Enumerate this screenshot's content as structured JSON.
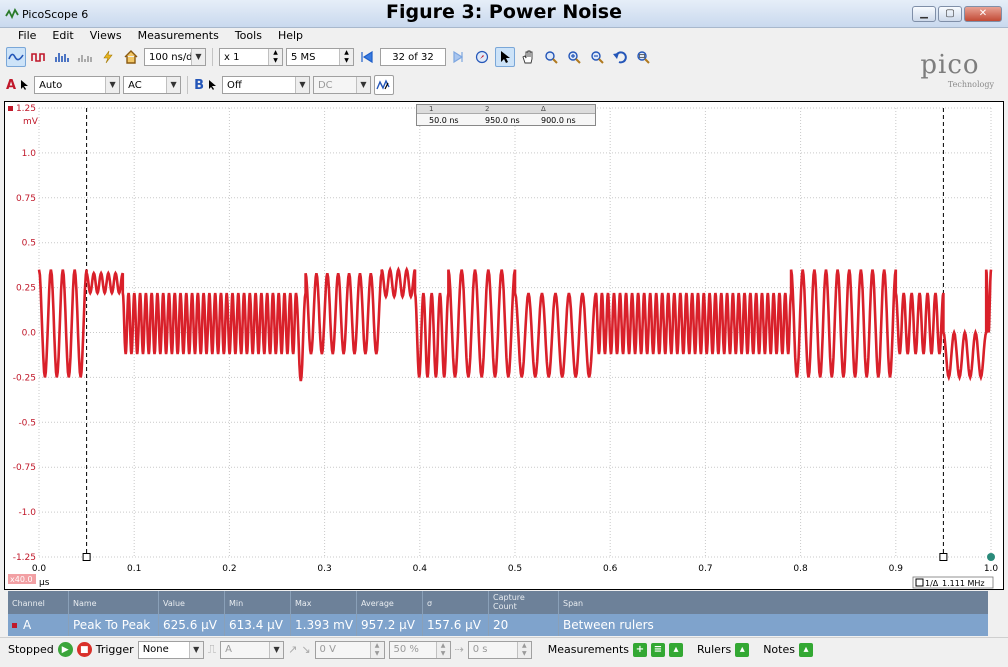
{
  "window": {
    "app_title": "PicoScope 6",
    "figure_title": "Figure 3: Power Noise",
    "controls": {
      "minimize": "▁",
      "maximize": "▢",
      "close": "✕"
    }
  },
  "menu": [
    "File",
    "Edit",
    "Views",
    "Measurements",
    "Tools",
    "Help"
  ],
  "toolbar": {
    "timebase": "100 ns/div",
    "zoom": "x 1",
    "samples": "5 MS",
    "capture": "32 of 32"
  },
  "channel_bar": {
    "channel_a_label": "A",
    "channel_a_range": "Auto",
    "channel_a_coupling": "AC",
    "channel_b_label": "B",
    "channel_b_range": "Off",
    "channel_b_coupling": "DC"
  },
  "logo": {
    "main": "pico",
    "sub": "Technology"
  },
  "ruler_legend": {
    "headers": [
      "1",
      "2",
      "Δ"
    ],
    "values": [
      "50.0 ns",
      "950.0 ns",
      "900.0 ns"
    ]
  },
  "scope": {
    "y_unit": "mV",
    "x_unit": "µs",
    "zoom_badge": "x40.0",
    "freq_readout": "1.111 MHz",
    "trace_color": "#d9202a",
    "grid_color": "#c9c9c9"
  },
  "chart_data": {
    "type": "line",
    "xlim": [
      0.0,
      1.0
    ],
    "ylim": [
      -1.25,
      1.25
    ],
    "x_ticks": [
      "0.0",
      "0.1",
      "0.2",
      "0.3",
      "0.4",
      "0.5",
      "0.6",
      "0.7",
      "0.8",
      "0.9",
      "1.0"
    ],
    "y_ticks": [
      "1.25",
      "1.0",
      "0.75",
      "0.5",
      "0.25",
      "0.0",
      "-0.25",
      "-0.5",
      "-0.75",
      "-1.0",
      "-1.25"
    ],
    "x_label": "µs",
    "y_label": "mV",
    "rulers_x": [
      0.05,
      0.95
    ],
    "grid": true,
    "series": [
      {
        "segments": [
          {
            "x0": 0.0,
            "x1": 0.05,
            "cycles": 4,
            "hi": 0.35,
            "lo": -0.25
          },
          {
            "x0": 0.05,
            "x1": 0.088,
            "cycles": 5,
            "hi": 0.33,
            "lo": 0.22
          },
          {
            "x0": 0.088,
            "x1": 0.27,
            "cycles": 30,
            "hi": 0.22,
            "lo": -0.12
          },
          {
            "x0": 0.27,
            "x1": 0.28,
            "cycles": 1,
            "hi": 0.22,
            "lo": -0.27
          },
          {
            "x0": 0.28,
            "x1": 0.36,
            "cycles": 7,
            "hi": 0.33,
            "lo": -0.12
          },
          {
            "x0": 0.36,
            "x1": 0.395,
            "cycles": 4,
            "hi": 0.35,
            "lo": 0.2
          },
          {
            "x0": 0.395,
            "x1": 0.43,
            "cycles": 4,
            "hi": 0.22,
            "lo": -0.25
          },
          {
            "x0": 0.43,
            "x1": 0.5,
            "cycles": 5,
            "hi": 0.35,
            "lo": -0.25
          },
          {
            "x0": 0.5,
            "x1": 0.585,
            "cycles": 6,
            "hi": 0.22,
            "lo": -0.25
          },
          {
            "x0": 0.585,
            "x1": 0.68,
            "cycles": 15,
            "hi": 0.22,
            "lo": -0.12
          },
          {
            "x0": 0.68,
            "x1": 0.79,
            "cycles": 18,
            "hi": 0.22,
            "lo": -0.12
          },
          {
            "x0": 0.79,
            "x1": 0.9,
            "cycles": 9,
            "hi": 0.35,
            "lo": -0.25
          },
          {
            "x0": 0.9,
            "x1": 0.95,
            "cycles": 6,
            "hi": 0.22,
            "lo": -0.12
          },
          {
            "x0": 0.95,
            "x1": 0.995,
            "cycles": 4,
            "hi": 0.0,
            "lo": -0.25
          },
          {
            "x0": 0.995,
            "x1": 1.0,
            "cycles": 1,
            "hi": 0.35,
            "lo": 0.0
          }
        ]
      }
    ]
  },
  "measurements": {
    "headers": [
      "Channel",
      "Name",
      "Value",
      "Min",
      "Max",
      "Average",
      "σ",
      "Capture\nCount",
      "Span"
    ],
    "row": [
      "A",
      "Peak To Peak",
      "625.6 µV",
      "613.4 µV",
      "1.393 mV",
      "957.2 µV",
      "157.6 µV",
      "20",
      "Between rulers"
    ]
  },
  "statusbar": {
    "status": "Stopped",
    "trigger_label": "Trigger",
    "trigger_mode": "None",
    "trigger_source": "A",
    "threshold": "0 V",
    "pretrigger": "50 %",
    "delay": "0 s",
    "measurements_label": "Measurements",
    "rulers_label": "Rulers",
    "notes_label": "Notes"
  }
}
